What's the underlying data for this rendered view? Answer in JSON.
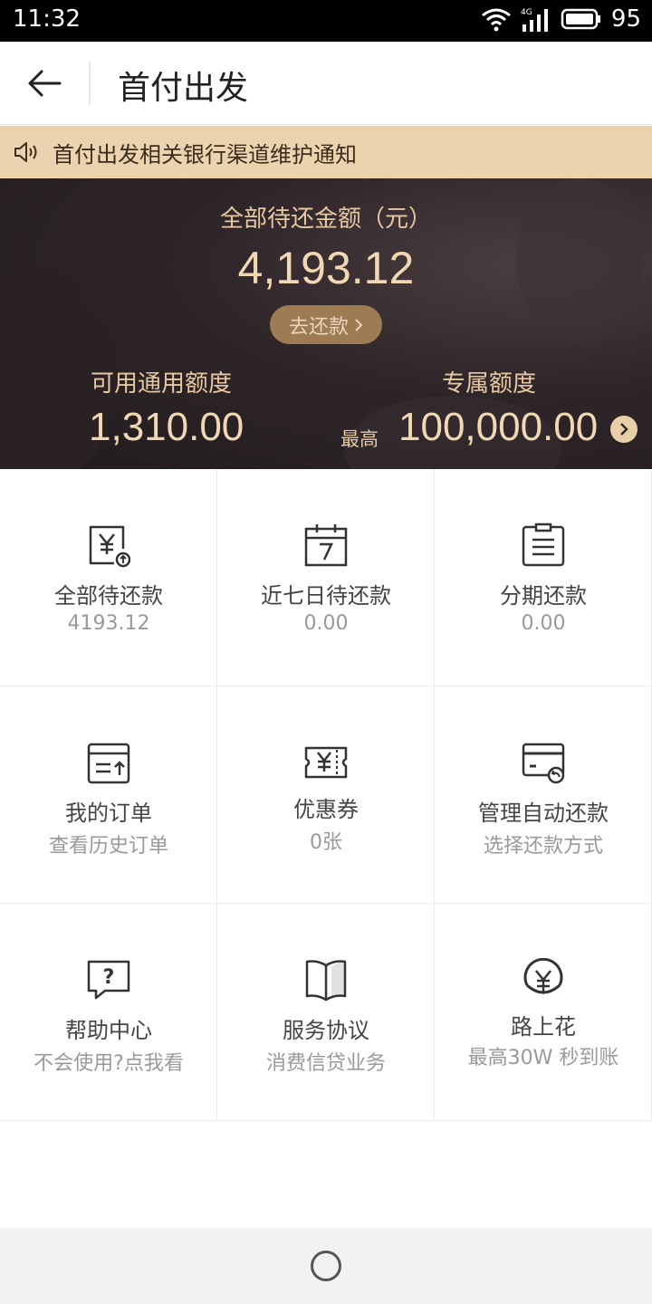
{
  "status_bar": {
    "time": "11:32",
    "battery": "95",
    "network": "4G"
  },
  "header": {
    "title": "首付出发"
  },
  "notice": {
    "text": "首付出发相关银行渠道维护通知"
  },
  "summary": {
    "label": "全部待还金额（元）",
    "amount": "4,193.12",
    "repay_button": "去还款",
    "general_credit": {
      "label": "可用通用额度",
      "amount": "1,310.00"
    },
    "exclusive_credit": {
      "label": "专属额度",
      "prefix": "最高",
      "amount": "100,000.00"
    }
  },
  "grid": [
    {
      "title": "全部待还款",
      "sub": "4193.12",
      "icon": "yen-bill-icon"
    },
    {
      "title": "近七日待还款",
      "sub": "0.00",
      "icon": "calendar-7-icon"
    },
    {
      "title": "分期还款",
      "sub": "0.00",
      "icon": "clipboard-list-icon"
    },
    {
      "title": "我的订单",
      "sub": "查看历史订单",
      "icon": "order-icon"
    },
    {
      "title": "优惠券",
      "sub": "0张",
      "icon": "coupon-icon"
    },
    {
      "title": "管理自动还款",
      "sub": "选择还款方式",
      "icon": "card-auto-icon"
    },
    {
      "title": "帮助中心",
      "sub": "不会使用?点我看",
      "icon": "help-icon"
    },
    {
      "title": "服务协议",
      "sub": "消费信贷业务",
      "icon": "book-icon"
    },
    {
      "title": "路上花",
      "sub": "最高30W 秒到账",
      "icon": "yen-circle-icon"
    }
  ],
  "colors": {
    "accent_gold": "#f0d8b4",
    "notice_bg": "#ecd3b0",
    "button_bg": "#9d7b53"
  }
}
